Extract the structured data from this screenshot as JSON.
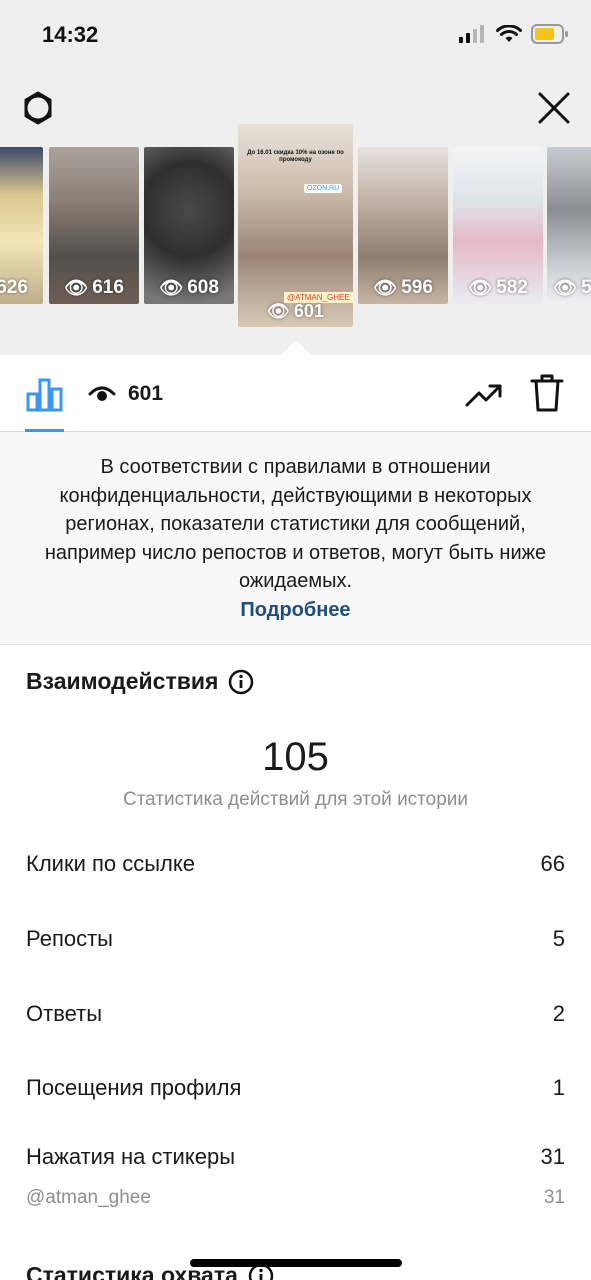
{
  "status": {
    "time": "14:32"
  },
  "stories": [
    {
      "views": "626",
      "bg": "#c9b88f"
    },
    {
      "views": "616",
      "bg": "#7a7068"
    },
    {
      "views": "608",
      "bg": "#5a5a5a"
    },
    {
      "views": "601",
      "bg": "#d9cfc2",
      "selected": true,
      "sticker_top": "До 16.01 скидка 10% на озоне по промокоду",
      "sticker_link": "OZON.RU",
      "sticker_code": "@ATMAN_GHEE"
    },
    {
      "views": "596",
      "bg": "#b8aaa0"
    },
    {
      "views": "582",
      "bg": "#dde0e6"
    },
    {
      "views": "5",
      "bg": "#9aa0a8"
    }
  ],
  "toolbar": {
    "views_count": "601"
  },
  "notice": {
    "text": "В соответствии с правилами в отношении конфиденциальности, действующими в некоторых регионах, показатели статистики для сообщений, например число репостов и ответов, могут быть ниже ожидаемых.",
    "link": "Подробнее"
  },
  "interactions": {
    "title": "Взаимодействия",
    "total": "105",
    "subtitle": "Статистика действий для этой истории",
    "rows": [
      {
        "label": "Клики по ссылке",
        "value": "66"
      },
      {
        "label": "Репосты",
        "value": "5"
      },
      {
        "label": "Ответы",
        "value": "2"
      },
      {
        "label": "Посещения профиля",
        "value": "1"
      },
      {
        "label": "Нажатия на стикеры",
        "value": "31"
      }
    ],
    "sticker_row": {
      "label": "@atman_ghee",
      "value": "31"
    }
  },
  "reach": {
    "title": "Статистика охвата"
  },
  "colors": {
    "accent": "#3897f0",
    "link": "#1e4f7c",
    "muted": "#8e8e8e"
  }
}
